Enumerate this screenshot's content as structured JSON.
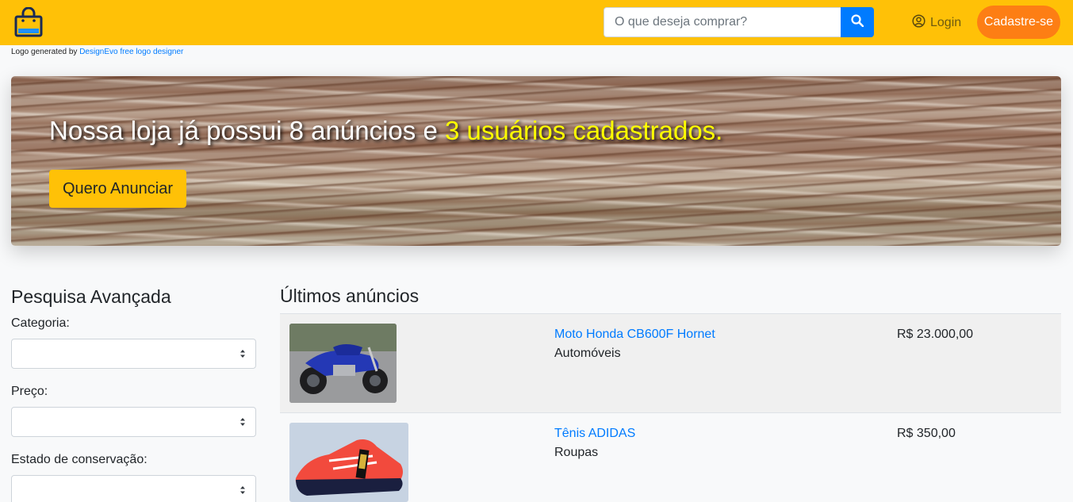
{
  "header": {
    "logo_icon": "shopping-bag-icon",
    "search_placeholder": "O que deseja comprar?",
    "search_icon": "search-icon",
    "login_label": "Login",
    "login_icon": "user-circle-icon",
    "signup_label": "Cadastre-se"
  },
  "credit": {
    "prefix": "Logo generated by",
    "link_text": "DesignEvo free logo designer"
  },
  "hero": {
    "title_part1": "Nossa loja já possui 8 anúncios e",
    "title_part2": "3 usuários cadastrados.",
    "button_label": "Quero Anunciar"
  },
  "sidebar": {
    "title": "Pesquisa Avançada",
    "fields": [
      {
        "label": "Categoria:",
        "value": ""
      },
      {
        "label": "Preço:",
        "value": ""
      },
      {
        "label": "Estado de conservação:",
        "value": ""
      }
    ]
  },
  "main": {
    "title": "Últimos anúncios",
    "ads": [
      {
        "title": "Moto Honda CB600F Hornet",
        "category": "Automóveis",
        "price": "R$ 23.000,00"
      },
      {
        "title": "Tênis ADIDAS",
        "category": "Roupas",
        "price": "R$ 350,00"
      }
    ]
  },
  "colors": {
    "navbar": "#ffc107",
    "accent_blue": "#007bff",
    "signup_orange": "#fd7e14",
    "hero_highlight": "#ffff00"
  }
}
